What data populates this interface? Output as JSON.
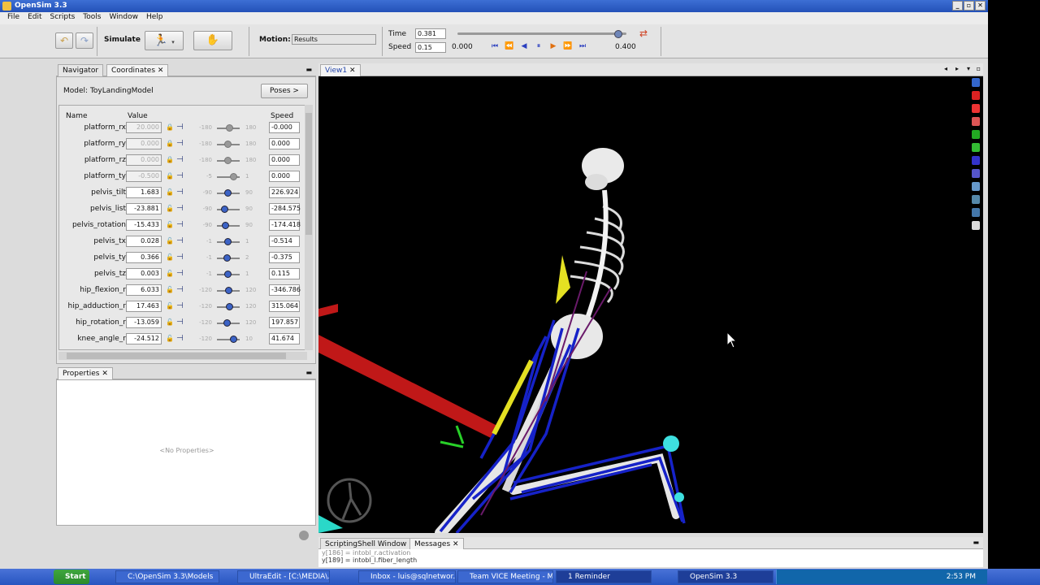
{
  "window": {
    "title": "OpenSim 3.3"
  },
  "menu": [
    "File",
    "Edit",
    "Scripts",
    "Tools",
    "Window",
    "Help"
  ],
  "toolbar": {
    "simulate_label": "Simulate",
    "motion_label": "Motion:",
    "motion_value": "Results",
    "time_label": "Time",
    "time_value": "0.381",
    "speed_label": "Speed",
    "speed_value": "0.15",
    "range_start": "0.000",
    "range_end": "0.400",
    "time_fraction": 0.95
  },
  "navigator": {
    "tabs": [
      "Navigator",
      "Coordinates"
    ],
    "model_label": "Model:",
    "model_name": "ToyLandingModel",
    "poses_label": "Poses >",
    "headers": {
      "name": "Name",
      "value": "Value",
      "speed": "Speed"
    },
    "rows": [
      {
        "name": "platform_rx",
        "value": "20.000",
        "locked": true,
        "min": "-180",
        "max": "180",
        "level": 0.56,
        "speed": "-0.000"
      },
      {
        "name": "platform_ry",
        "value": "0.000",
        "locked": true,
        "min": "-180",
        "max": "180",
        "level": 0.5,
        "speed": "0.000"
      },
      {
        "name": "platform_rz",
        "value": "0.000",
        "locked": true,
        "min": "-180",
        "max": "180",
        "level": 0.5,
        "speed": "0.000"
      },
      {
        "name": "platform_ty",
        "value": "-0.500",
        "locked": true,
        "min": "-5",
        "max": "1",
        "level": 0.75,
        "speed": "0.000"
      },
      {
        "name": "pelvis_tilt",
        "value": "1.683",
        "locked": false,
        "min": "-90",
        "max": "90",
        "level": 0.51,
        "speed": "226.924"
      },
      {
        "name": "pelvis_list",
        "value": "-23.881",
        "locked": false,
        "min": "-90",
        "max": "90",
        "level": 0.37,
        "speed": "-284.575"
      },
      {
        "name": "pelvis_rotation",
        "value": "-15.433",
        "locked": false,
        "min": "-90",
        "max": "90",
        "level": 0.41,
        "speed": "-174.418"
      },
      {
        "name": "pelvis_tx",
        "value": "0.028",
        "locked": false,
        "min": "-1",
        "max": "1",
        "level": 0.51,
        "speed": "-0.514"
      },
      {
        "name": "pelvis_ty",
        "value": "0.366",
        "locked": false,
        "min": "-1",
        "max": "2",
        "level": 0.45,
        "speed": "-0.375"
      },
      {
        "name": "pelvis_tz",
        "value": "0.003",
        "locked": false,
        "min": "-1",
        "max": "1",
        "level": 0.5,
        "speed": "0.115"
      },
      {
        "name": "hip_flexion_r",
        "value": "6.033",
        "locked": false,
        "min": "-120",
        "max": "120",
        "level": 0.52,
        "speed": "-346.786"
      },
      {
        "name": "hip_adduction_r",
        "value": "17.463",
        "locked": false,
        "min": "-120",
        "max": "120",
        "level": 0.57,
        "speed": "315.064"
      },
      {
        "name": "hip_rotation_r",
        "value": "-13.059",
        "locked": false,
        "min": "-120",
        "max": "120",
        "level": 0.45,
        "speed": "197.857"
      },
      {
        "name": "knee_angle_r",
        "value": "-24.512",
        "locked": false,
        "min": "-120",
        "max": "10",
        "level": 0.74,
        "speed": "41.674"
      }
    ]
  },
  "properties": {
    "tab": "Properties",
    "empty_text": "<No Properties>"
  },
  "view": {
    "tab": "View1"
  },
  "bottom": {
    "tabs": [
      "ScriptingShell Window",
      "Messages"
    ],
    "lines": [
      "y[186] = intobl_r.activation",
      "y[189] = intobl_l.fiber_length"
    ]
  },
  "taskbar": {
    "start": "Start",
    "tasks": [
      "C:\\OpenSim 3.3\\Models",
      "UltraEdit - [C:\\MEDIA\\...",
      "Inbox - luis@sqlnetwor...",
      "Team VICE Meeting - M...",
      "1 Reminder",
      "OpenSim 3.3"
    ],
    "clock": "2:53 PM"
  },
  "colors": {
    "muscle": "#1622c8",
    "bone": "#e6e6e6",
    "platform": "#c01818",
    "marker": "#3ee0e0",
    "accent_yellow": "#e4e022"
  }
}
